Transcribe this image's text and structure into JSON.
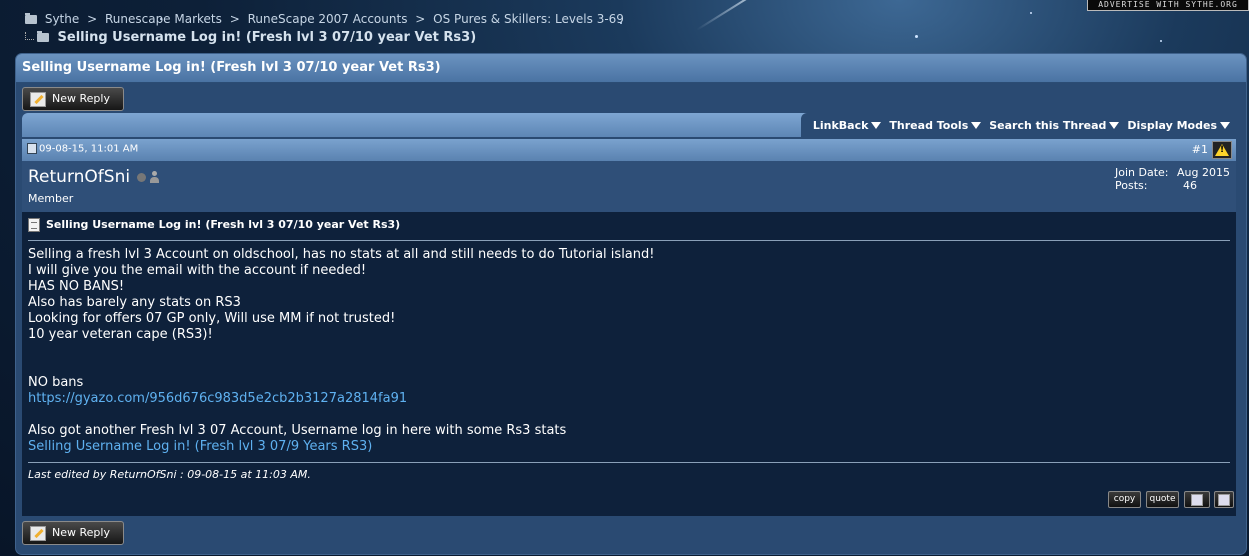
{
  "advert": "ADVERTISE WITH SYTHE.ORG",
  "breadcrumb": [
    "Sythe",
    "Runescape Markets",
    "RuneScape 2007 Accounts",
    "OS Pures & Skillers: Levels 3-69"
  ],
  "breadcrumb_separator": ">",
  "thread_title": "Selling Username Log in! (Fresh lvl 3 07/10 year Vet Rs3)",
  "new_reply_label": "New Reply",
  "tools": [
    "LinkBack",
    "Thread Tools",
    "Search this Thread",
    "Display Modes"
  ],
  "post": {
    "date": "09-08-15, 11:01 AM",
    "number": "#1",
    "username": "ReturnOfSni",
    "user_title": "Member",
    "join_date_label": "Join Date:",
    "join_date": "Aug 2015",
    "posts_label": "Posts:",
    "posts": "46",
    "title": "Selling Username Log in! (Fresh lvl 3 07/10 year Vet Rs3)",
    "lines": [
      "Selling a fresh lvl 3 Account on oldschool, has no stats at all and still needs to do Tutorial island!",
      "I will give you the email with the account if needed!",
      "HAS NO BANS!",
      "Also has barely any stats on RS3",
      "Looking for offers 07 GP only, Will use MM if not trusted!",
      "10 year veteran cape (RS3)!",
      "NO bans"
    ],
    "link1": "https://gyazo.com/956d676c983d5e2cb2b3127a2814fa91",
    "line_after": "Also got another Fresh lvl 3 07 Account, Username log in here with some Rs3 stats",
    "link2": "Selling Username Log in! (Fresh lvl 3 07/9 Years RS3)",
    "last_edited": "Last edited by ReturnOfSni : 09-08-15 at 11:03 AM.",
    "actions": [
      "copy",
      "quote"
    ]
  },
  "colors": {
    "accent_bar": "#6b93c0",
    "post_bg": "#0e213b",
    "link": "#5fb1f0"
  }
}
